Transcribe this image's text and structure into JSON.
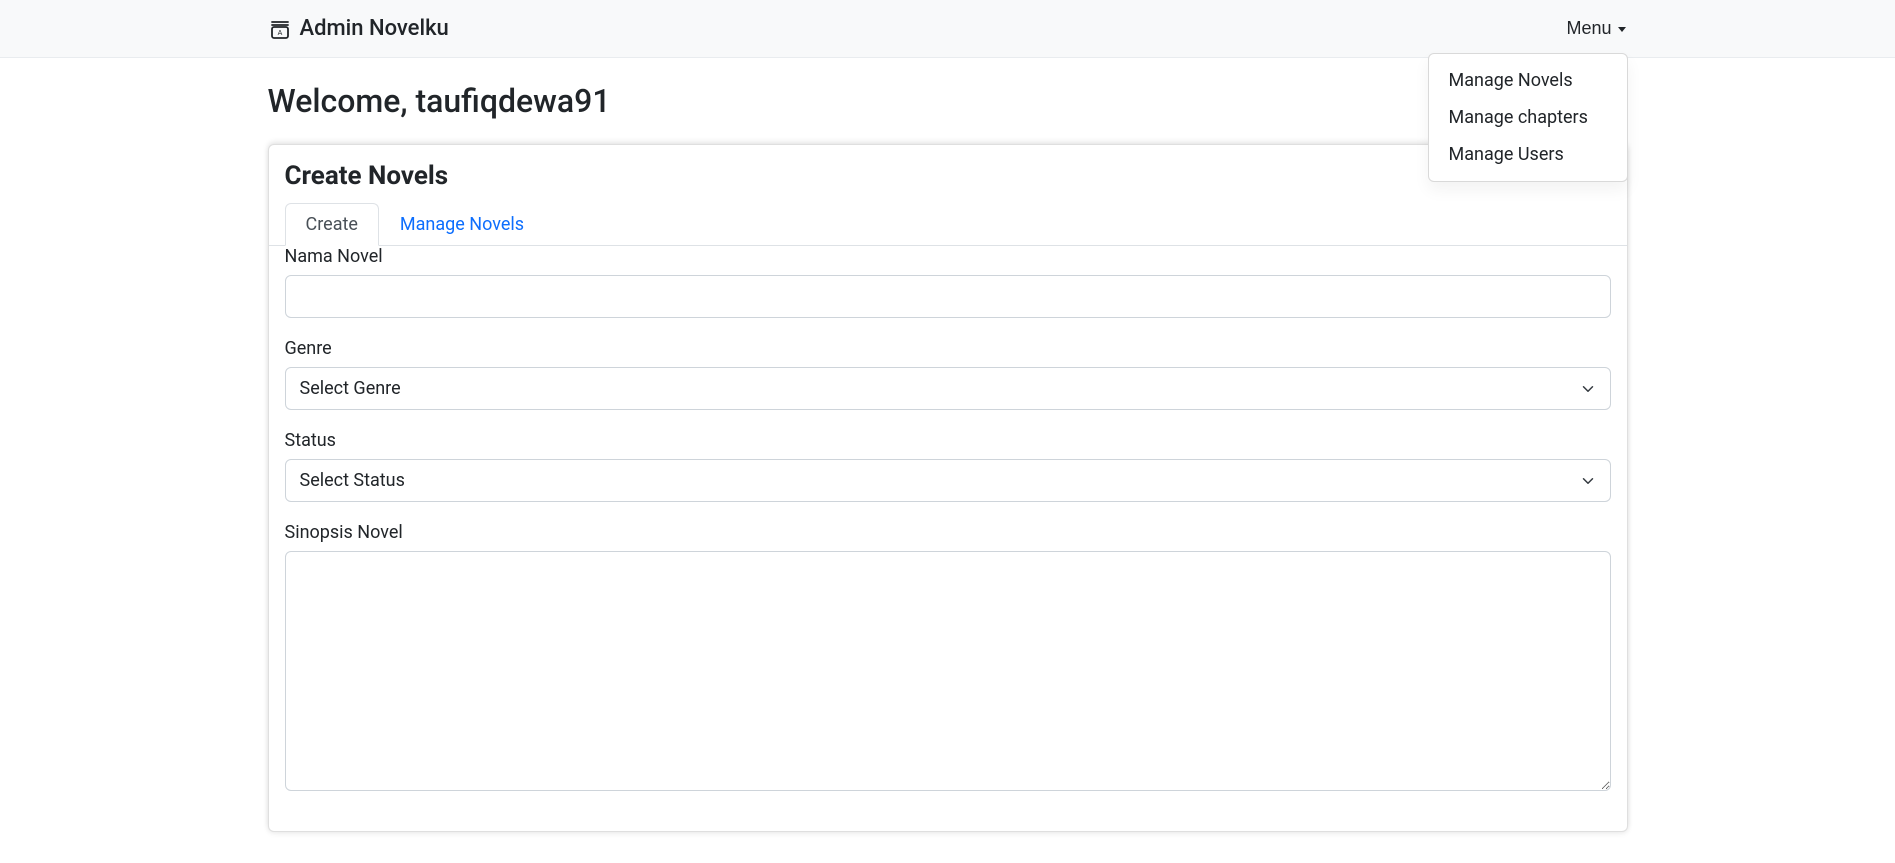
{
  "navbar": {
    "brand": "Admin Novelku",
    "menu_label": "Menu",
    "dropdown": {
      "items": [
        {
          "label": "Manage Novels"
        },
        {
          "label": "Manage chapters"
        },
        {
          "label": "Manage Users"
        }
      ]
    }
  },
  "welcome": "Welcome, taufiqdewa91",
  "card": {
    "title": "Create Novels",
    "tabs": [
      {
        "label": "Create",
        "active": true
      },
      {
        "label": "Manage Novels",
        "active": false
      }
    ],
    "form": {
      "nama_label": "Nama Novel",
      "nama_value": "",
      "genre_label": "Genre",
      "genre_selected": "Select Genre",
      "status_label": "Status",
      "status_selected": "Select Status",
      "sinopsis_label": "Sinopsis Novel",
      "sinopsis_value": ""
    }
  }
}
